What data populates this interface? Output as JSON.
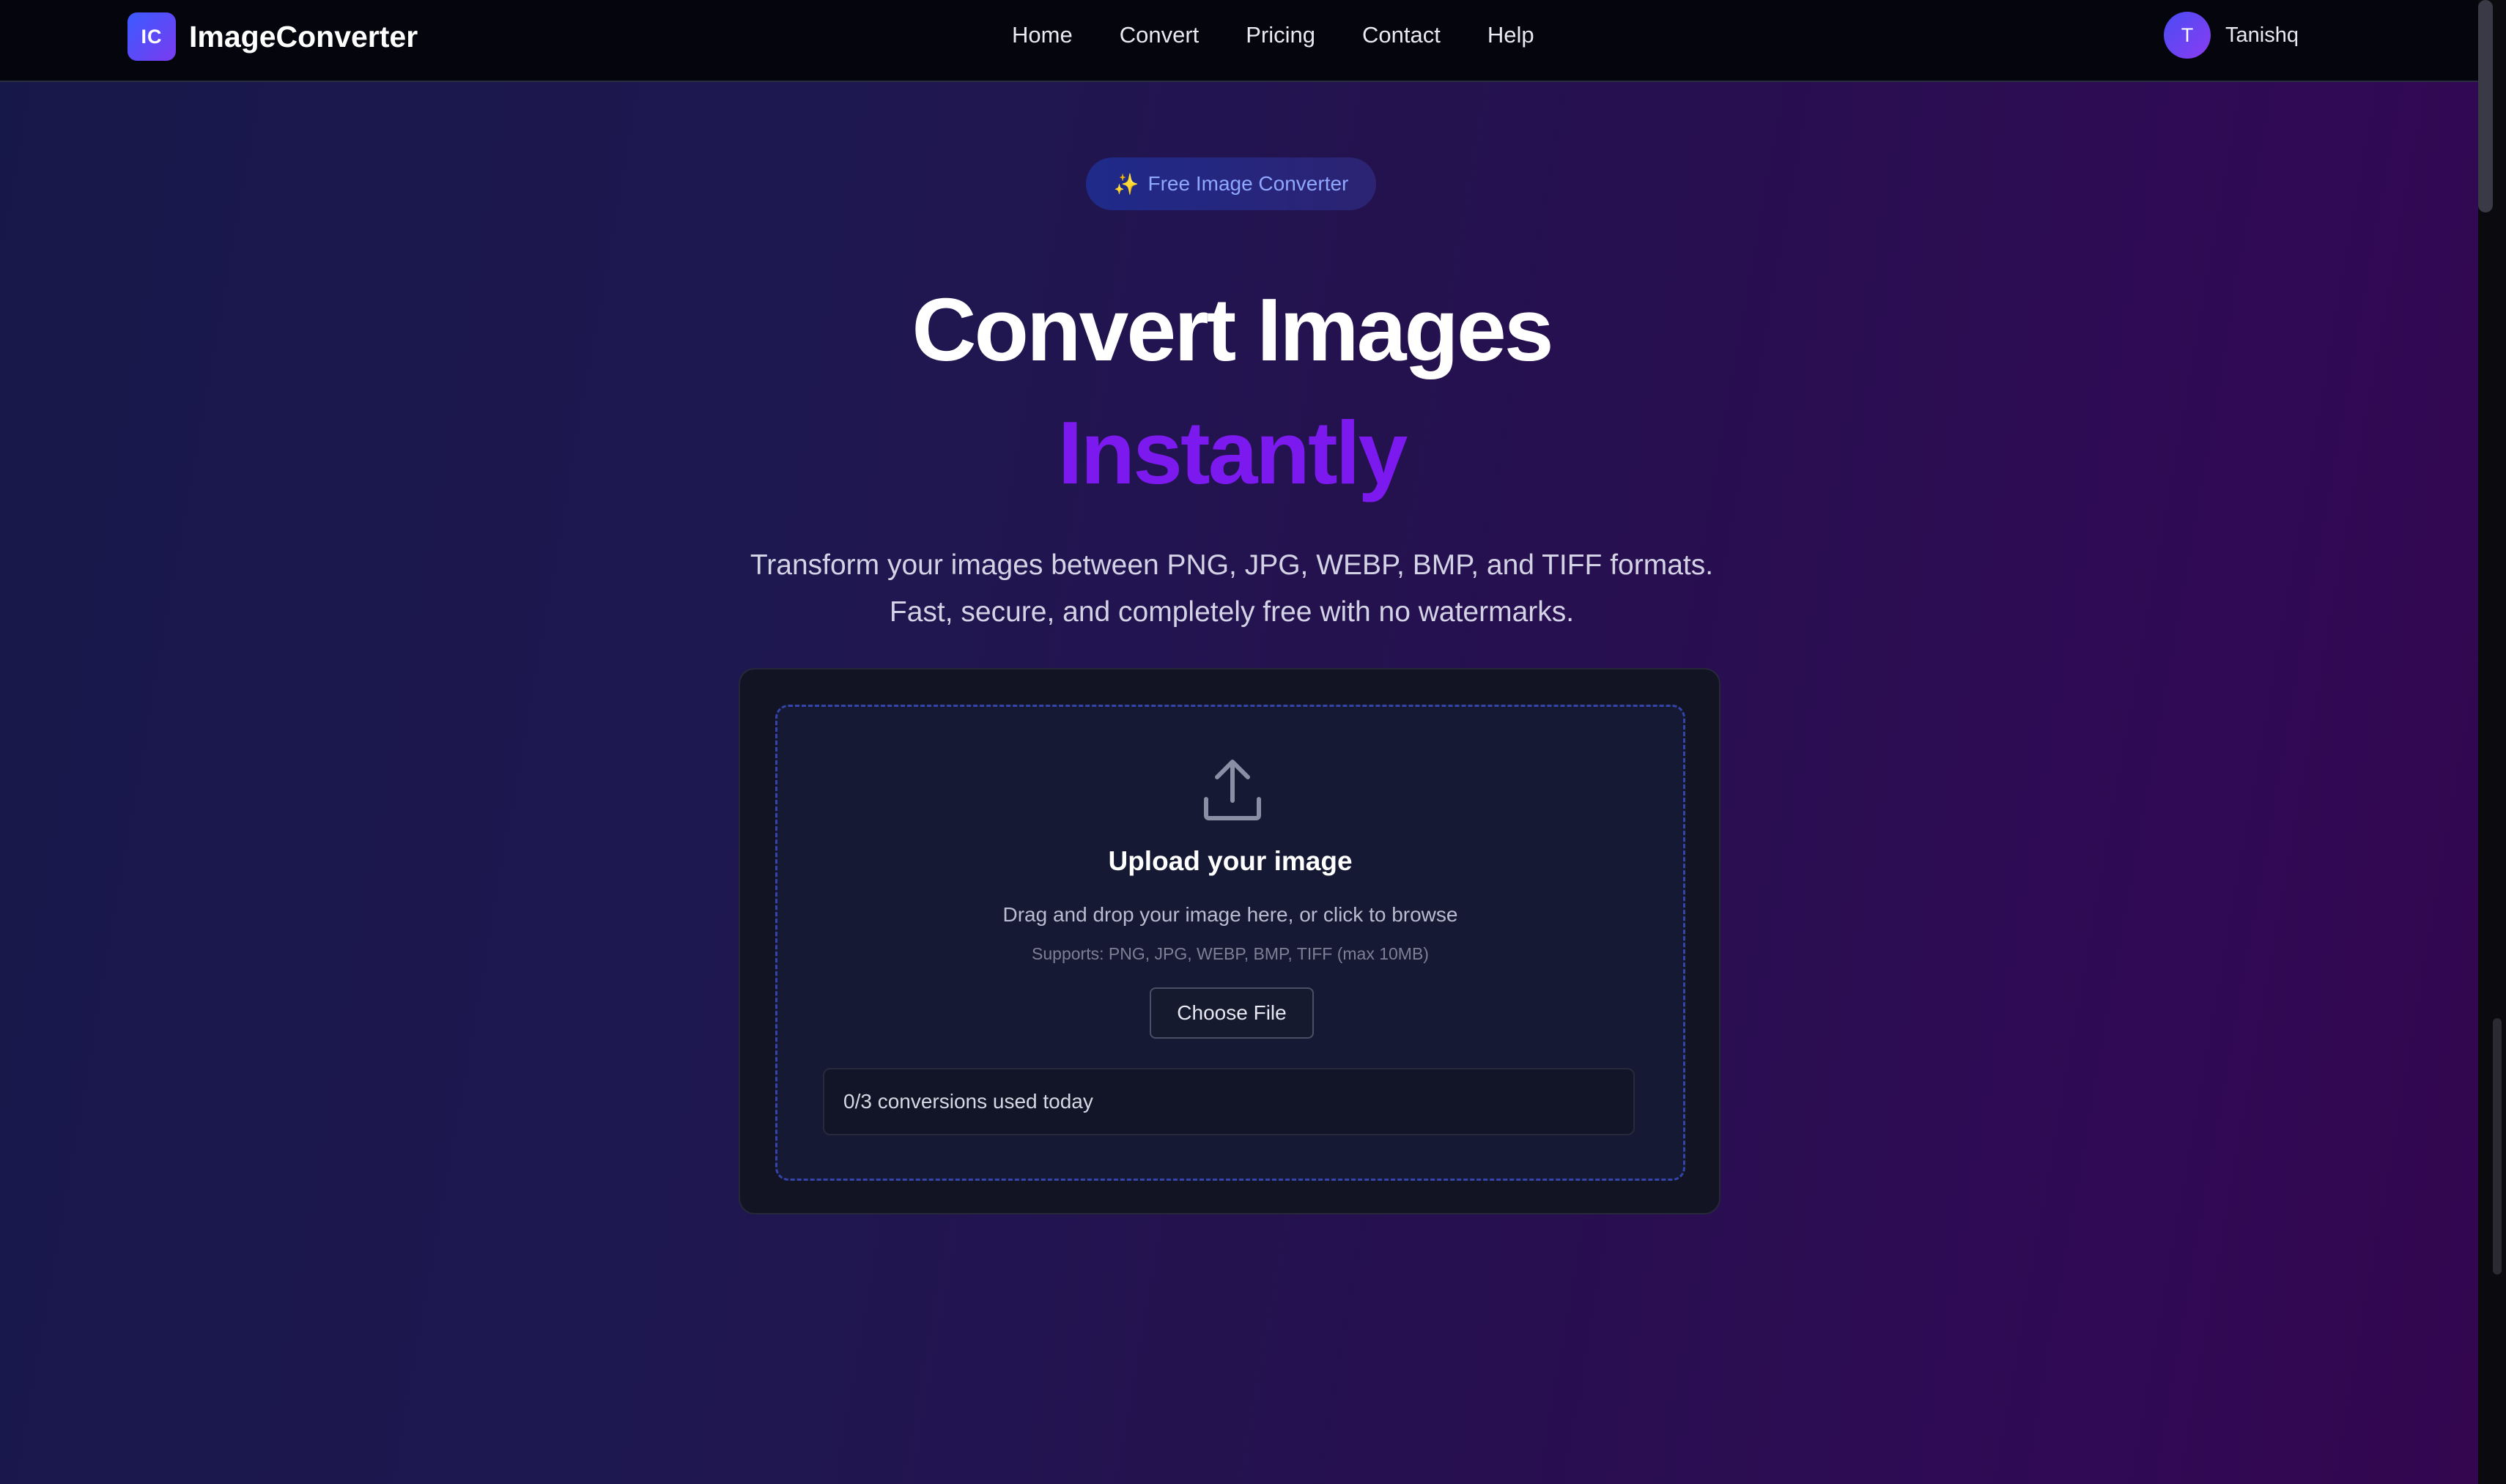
{
  "app": {
    "logo_badge": "IC",
    "logo_text": "ImageConverter"
  },
  "nav": {
    "links": [
      "Home",
      "Convert",
      "Pricing",
      "Contact",
      "Help"
    ]
  },
  "user": {
    "initial": "T",
    "name": "Tanishq"
  },
  "hero": {
    "pill_icon": "✨",
    "pill_text": "Free Image Converter",
    "title_line1": "Convert Images",
    "title_line2": "Instantly",
    "subtitle_line1": "Transform your images between PNG, JPG, WEBP, BMP, and TIFF formats.",
    "subtitle_line2": "Fast, secure, and completely free with no watermarks."
  },
  "upload": {
    "icon": "upload-icon",
    "title": "Upload your image",
    "description": "Drag and drop your image here, or click to browse",
    "supports": "Supports: PNG, JPG, WEBP, BMP, TIFF (max 10MB)",
    "button_label": "Choose File",
    "usage_text": "0/3 conversions used today"
  },
  "colors": {
    "accent_purple": "#7c19ee",
    "logo_gradient_start": "#3b5bff",
    "logo_gradient_end": "#7a3bf0",
    "pill_text": "#8fa7ff",
    "dropzone_border": "#3544a8"
  }
}
